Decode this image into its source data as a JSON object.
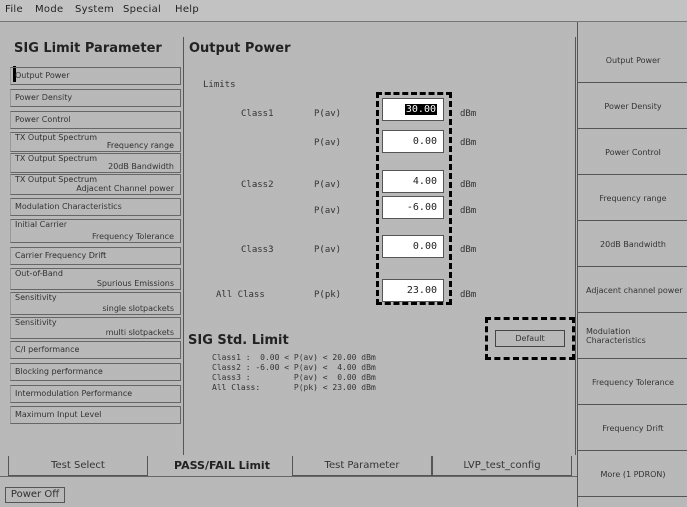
{
  "menubar": [
    "File",
    "Mode",
    "System",
    "Special",
    "Help"
  ],
  "left_panel": {
    "title": "SIG Limit Parameter",
    "items": [
      {
        "line1": "Output Power",
        "line2": ""
      },
      {
        "line1": "Power Density",
        "line2": ""
      },
      {
        "line1": "Power Control",
        "line2": ""
      },
      {
        "line1": "TX Output Spectrum",
        "line2": "Frequency range"
      },
      {
        "line1": "TX Output Spectrum",
        "line2": "20dB Bandwidth"
      },
      {
        "line1": "TX Output Spectrum",
        "line2": "Adjacent Channel power"
      },
      {
        "line1": "Modulation Characteristics",
        "line2": ""
      },
      {
        "line1": "Initial Carrier",
        "line2": "Frequency Tolerance"
      },
      {
        "line1": "Carrier Frequency Drift",
        "line2": ""
      },
      {
        "line1": "Out-of-Band",
        "line2": "Spurious Emissions"
      },
      {
        "line1": "Sensitivity",
        "line2": "single slotpackets"
      },
      {
        "line1": "Sensitivity",
        "line2": "multi slotpackets"
      },
      {
        "line1": "C/I performance",
        "line2": ""
      },
      {
        "line1": "Blocking performance",
        "line2": ""
      },
      {
        "line1": "Intermodulation Performance",
        "line2": ""
      },
      {
        "line1": "Maximum Input Level",
        "line2": ""
      }
    ]
  },
  "main": {
    "title": "Output Power",
    "limits_label": "Limits",
    "rows": [
      {
        "class": "Class1",
        "param": "P(av)",
        "value": "30.00",
        "unit": "dBm",
        "selected": true
      },
      {
        "class": "",
        "param": "P(av)",
        "value": "0.00",
        "unit": "dBm",
        "selected": false
      },
      {
        "class": "Class2",
        "param": "P(av)",
        "value": "4.00",
        "unit": "dBm",
        "selected": false
      },
      {
        "class": "",
        "param": "P(av)",
        "value": "-6.00",
        "unit": "dBm",
        "selected": false
      },
      {
        "class": "Class3",
        "param": "P(av)",
        "value": "0.00",
        "unit": "dBm",
        "selected": false
      },
      {
        "class": "All Class",
        "param": "P(pk)",
        "value": "23.00",
        "unit": "dBm",
        "selected": false
      }
    ],
    "std_title": "SIG Std. Limit",
    "std_lines": [
      "Class1 :  0.00 < P(av) < 20.00 dBm",
      "Class2 : -6.00 < P(av) <  4.00 dBm",
      "Class3 :         P(av) <  0.00 dBm",
      "All Class:       P(pk) < 23.00 dBm"
    ],
    "default_button": "Default"
  },
  "right_panel": [
    {
      "label": "Output Power"
    },
    {
      "label": "Power Density"
    },
    {
      "label": "Power Control"
    },
    {
      "label": "Frequency range"
    },
    {
      "label": "20dB Bandwidth"
    },
    {
      "label": "Adjacent channel power"
    },
    {
      "label": "Modulation Characteristics"
    },
    {
      "label": "Frequency Tolerance"
    },
    {
      "label": "Frequency Drift"
    },
    {
      "label": "More (1 PDRON)"
    }
  ],
  "bottom_tabs": [
    {
      "label": "Test Select",
      "active": false
    },
    {
      "label": "PASS/FAIL Limit",
      "active": true
    },
    {
      "label": "Test Parameter",
      "active": false
    },
    {
      "label": "LVP_test_config",
      "active": false
    }
  ],
  "power_off": "Power Off"
}
